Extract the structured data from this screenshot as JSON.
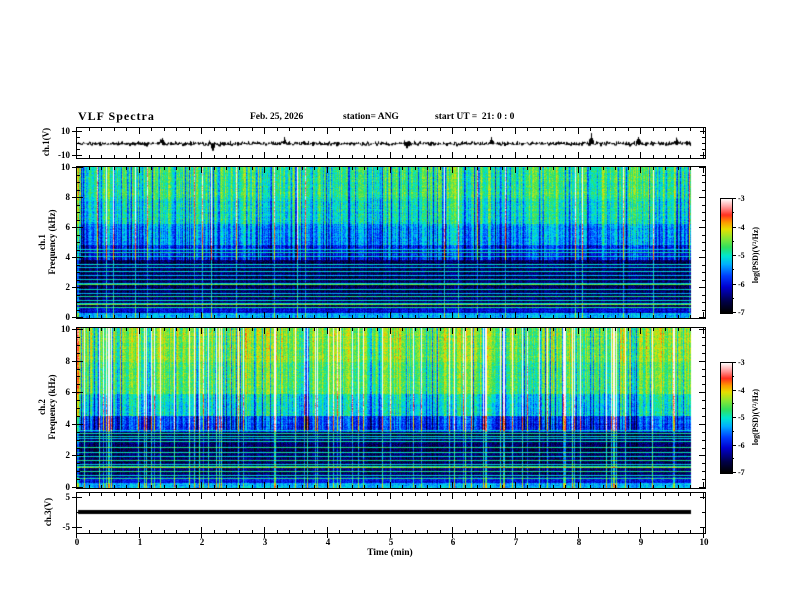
{
  "header": {
    "title": "VLF Spectra",
    "date": "Feb. 25, 2026",
    "station": "station= ANG",
    "start_ut": "start UT =  21: 0 : 0"
  },
  "x_axis": {
    "label": "Time (min)",
    "range": [
      0,
      10
    ],
    "tick_values": [
      0,
      1,
      2,
      3,
      4,
      5,
      6,
      7,
      8,
      9,
      10
    ],
    "tick_labels": [
      "0",
      "1",
      "2",
      "3",
      "4",
      "5",
      "6",
      "7",
      "8",
      "9",
      "10"
    ],
    "minor_step": 0.2,
    "data_end_min": 9.8
  },
  "panels": [
    {
      "ylabel": "ch.1(V)",
      "ytick_values": [
        10,
        -10
      ],
      "ytick_labels": [
        "10",
        "-10"
      ],
      "yminor_values": [
        5,
        0,
        -5
      ]
    },
    {
      "ylabel_channel": "ch.1",
      "ylabel_axis": "Frequency (kHz)",
      "ytick_values": [
        0,
        2,
        4,
        6,
        8,
        10
      ],
      "ytick_labels": [
        "0",
        "2",
        "4",
        "6",
        "8",
        "10"
      ],
      "yminor_step": 0.5
    },
    {
      "ylabel_channel": "ch.2",
      "ylabel_axis": "Frequency (kHz)",
      "ytick_values": [
        0,
        2,
        4,
        6,
        8,
        10
      ],
      "ytick_labels": [
        "0",
        "2",
        "4",
        "6",
        "8",
        "10"
      ],
      "yminor_step": 0.5
    },
    {
      "ylabel": "ch.3(V)",
      "ytick_values": [
        5,
        -5
      ],
      "ytick_labels": [
        "5",
        "-5"
      ],
      "yminor_values": [
        0
      ]
    }
  ],
  "colorbar": {
    "label": "log(PSD)(V²/Hz)",
    "tick_values": [
      -3,
      -4,
      -5,
      -6,
      -7
    ],
    "tick_labels": [
      "-3",
      "-4",
      "-5",
      "-6",
      "-7"
    ],
    "range_top_to_bottom": [
      -3,
      -7
    ]
  },
  "chart_data": [
    {
      "type": "line",
      "panel": "ch.1(V) waveform",
      "x_label": "Time (min)",
      "x_range_min": [
        0,
        9.8
      ],
      "y_range_V": [
        -10,
        10
      ],
      "description": "Dense broadband noise trace centered on 0 V, typical excursion ±2 V with sporadic impulses",
      "noise_std_V": 0.9,
      "spikes": [
        {
          "t_min": 1.35,
          "amp_V": 4
        },
        {
          "t_min": 2.15,
          "amp_V": -5
        },
        {
          "t_min": 3.3,
          "amp_V": 3.5
        },
        {
          "t_min": 5.25,
          "amp_V": -4.5
        },
        {
          "t_min": 6.6,
          "amp_V": 3.5
        },
        {
          "t_min": 8.2,
          "amp_V": 7
        },
        {
          "t_min": 8.95,
          "amp_V": 6
        },
        {
          "t_min": 9.55,
          "amp_V": 4
        }
      ],
      "seed": 5
    },
    {
      "type": "heatmap",
      "panel": "ch.1 spectrogram",
      "x_range_min": [
        0,
        9.8
      ],
      "y_range_kHz": [
        0,
        10
      ],
      "z_label": "log(PSD)(V²/Hz)",
      "z_range": [
        -7,
        -3
      ],
      "background_bands": [
        {
          "f_min": 0,
          "f_max": 0.35,
          "level": -5.3
        },
        {
          "f_min": 0.35,
          "f_max": 0.7,
          "level": -6.0
        },
        {
          "f_min": 0.7,
          "f_max": 3.9,
          "level": -6.5
        },
        {
          "f_min": 3.9,
          "f_max": 4.9,
          "level": -5.8
        },
        {
          "f_min": 4.9,
          "f_max": 6.3,
          "level": -5.3
        },
        {
          "f_min": 6.3,
          "f_max": 8.0,
          "level": -4.9
        },
        {
          "f_min": 8.0,
          "f_max": 10.0,
          "level": -4.7
        }
      ],
      "harmonic_lines": [
        {
          "f_kHz": 4.6,
          "level": -5.0
        },
        {
          "f_kHz": 4.38,
          "level": -4.9
        },
        {
          "f_kHz": 4.15,
          "level": -5.0
        },
        {
          "f_kHz": 3.62,
          "level": -5.0
        },
        {
          "f_kHz": 3.38,
          "level": -5.1
        },
        {
          "f_kHz": 3.12,
          "level": -5.0
        },
        {
          "f_kHz": 2.86,
          "level": -5.2
        },
        {
          "f_kHz": 2.6,
          "level": -5.0
        },
        {
          "f_kHz": 2.28,
          "level": -4.5
        },
        {
          "f_kHz": 1.95,
          "level": -5.0
        },
        {
          "f_kHz": 1.68,
          "level": -5.2
        },
        {
          "f_kHz": 1.45,
          "level": -4.8
        },
        {
          "f_kHz": 1.18,
          "level": -5.0
        },
        {
          "f_kHz": 0.92,
          "level": -4.4
        },
        {
          "f_kHz": 0.72,
          "level": -4.8
        }
      ],
      "striation_split_kHz": 3.9,
      "hot_streak_probability": 0.05,
      "hot_streak_boost": 1.1,
      "seed": 11
    },
    {
      "type": "heatmap",
      "panel": "ch.2 spectrogram",
      "x_range_min": [
        0,
        9.8
      ],
      "y_range_kHz": [
        0,
        10
      ],
      "z_label": "log(PSD)(V²/Hz)",
      "z_range": [
        -7,
        -3
      ],
      "background_bands": [
        {
          "f_min": 0,
          "f_max": 0.35,
          "level": -5.3
        },
        {
          "f_min": 0.35,
          "f_max": 0.7,
          "level": -6.0
        },
        {
          "f_min": 0.7,
          "f_max": 3.6,
          "level": -6.52
        },
        {
          "f_min": 3.6,
          "f_max": 4.6,
          "level": -5.7
        },
        {
          "f_min": 4.6,
          "f_max": 6.0,
          "level": -5.0
        },
        {
          "f_min": 6.0,
          "f_max": 8.0,
          "level": -4.6
        },
        {
          "f_min": 8.0,
          "f_max": 10.0,
          "level": -4.4
        }
      ],
      "harmonic_lines": [
        {
          "f_kHz": 3.68,
          "level": -5.0
        },
        {
          "f_kHz": 3.5,
          "level": -4.85
        },
        {
          "f_kHz": 3.32,
          "level": -5.0
        },
        {
          "f_kHz": 3.15,
          "level": -5.1
        },
        {
          "f_kHz": 2.95,
          "level": -4.9
        },
        {
          "f_kHz": 2.62,
          "level": -4.8
        },
        {
          "f_kHz": 2.3,
          "level": -4.9
        },
        {
          "f_kHz": 2.05,
          "level": -5.0
        },
        {
          "f_kHz": 1.78,
          "level": -4.8
        },
        {
          "f_kHz": 1.5,
          "level": -5.0
        },
        {
          "f_kHz": 1.35,
          "level": -4.35
        },
        {
          "f_kHz": 1.1,
          "level": -4.8
        },
        {
          "f_kHz": 0.85,
          "level": -5.0
        },
        {
          "f_kHz": 0.62,
          "level": -4.8
        }
      ],
      "striation_split_kHz": 3.6,
      "hot_streak_probability": 0.11,
      "hot_streak_boost": 1.35,
      "seed": 77
    },
    {
      "type": "line",
      "panel": "ch.3(V) waveform",
      "x_range_min": [
        0,
        9.8
      ],
      "y_range_V": [
        -5,
        5
      ],
      "value_V": 0,
      "description": "Constant thick trace at ≈0 V for full record"
    }
  ],
  "colormap_stops": [
    [
      -7.0,
      "#000000"
    ],
    [
      -6.6,
      "#00004a"
    ],
    [
      -6.1,
      "#0000d0"
    ],
    [
      -5.7,
      "#0040ff"
    ],
    [
      -5.3,
      "#00b0ff"
    ],
    [
      -5.0,
      "#00e8d0"
    ],
    [
      -4.7,
      "#30e060"
    ],
    [
      -4.35,
      "#90e830"
    ],
    [
      -4.05,
      "#e8e000"
    ],
    [
      -3.8,
      "#ff9800"
    ],
    [
      -3.55,
      "#ff3020"
    ],
    [
      -3.3,
      "#ff9090"
    ],
    [
      -3.0,
      "#fff8f8"
    ]
  ]
}
